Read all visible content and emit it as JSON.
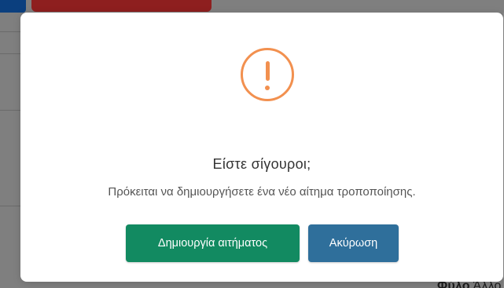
{
  "dialog": {
    "icon": "exclamation-circle-icon",
    "title": "Είστε σίγουροι;",
    "message": "Πρόκειται να δημιουργήσετε ένα νέο αίτημα τροποποίησης.",
    "confirm_label": "Δημιουργία αιτήματος",
    "cancel_label": "Ακύρωση",
    "colors": {
      "icon": "#f2904f",
      "confirm": "#128a61",
      "cancel": "#2f6f9b"
    }
  },
  "background": {
    "corner_text_bold": "Φύλο",
    "corner_text": " Άλλο"
  }
}
